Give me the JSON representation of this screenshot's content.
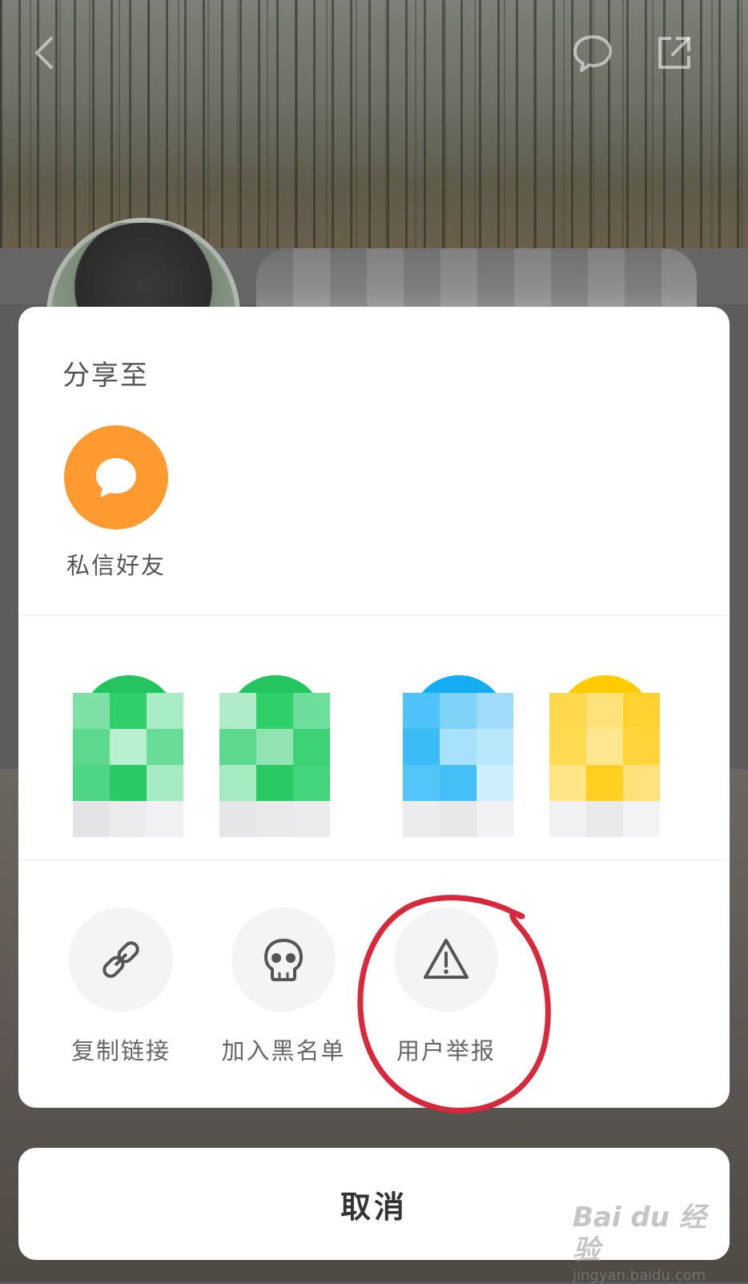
{
  "share_sheet": {
    "title": "分享至",
    "direct_message": {
      "label": "私信好友",
      "icon": "chat-bubble-icon",
      "color": "#ff9a30"
    },
    "apps": [
      {
        "icon": "pixelated-app-icon",
        "color": "#2fcf6a"
      },
      {
        "icon": "pixelated-app-icon",
        "color": "#2fcf6a"
      },
      {
        "icon": "pixelated-app-icon",
        "color": "#1ab3f5"
      },
      {
        "icon": "pixelated-app-icon",
        "color": "#ffcc00"
      }
    ],
    "tools": [
      {
        "label": "复制链接",
        "icon": "link-icon"
      },
      {
        "label": "加入黑名单",
        "icon": "skull-icon"
      },
      {
        "label": "用户举报",
        "icon": "warning-icon"
      }
    ]
  },
  "cancel_label": "取消",
  "watermark": {
    "brand": "Bai du 经验",
    "url": "jingyan.baidu.com"
  },
  "annotation_color": "#d8283c"
}
